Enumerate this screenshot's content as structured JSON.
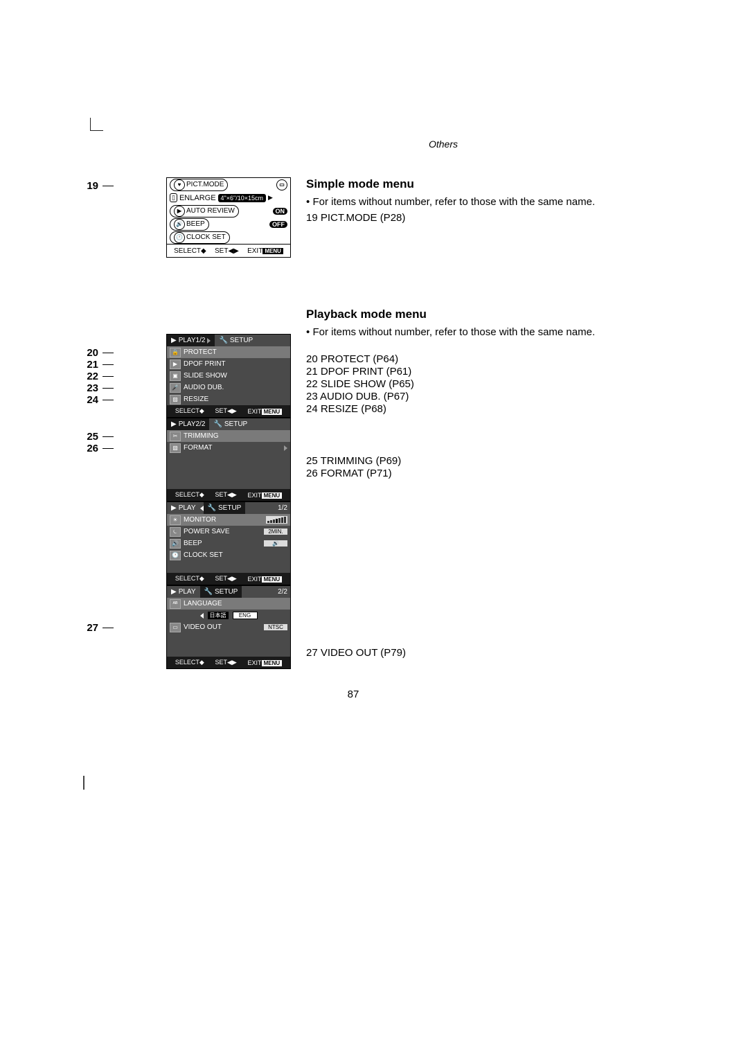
{
  "header": "Others",
  "page_number": "87",
  "simple": {
    "title": "Simple mode menu",
    "note_bullet": "•",
    "note": "For items without number, refer to those with the same name.",
    "items": [
      "19  PICT.MODE (P28)"
    ],
    "callout": "19",
    "screen": {
      "row1_label": "PICT.MODE",
      "row2_label": "ENLARGE",
      "row2_value": "4\"×6\"/10×15cm",
      "row3_label": "AUTO REVIEW",
      "row3_value": "ON",
      "row4_label": "BEEP",
      "row4_value": "OFF",
      "row5_label": "CLOCK SET",
      "footer_select": "SELECT",
      "footer_set": "SET",
      "footer_exit": "EXIT",
      "footer_menu": "MENU"
    }
  },
  "playback": {
    "title": "Playback mode menu",
    "note_bullet": "•",
    "note": "For items without number, refer to those with the same name.",
    "list1": [
      "20  PROTECT (P64)",
      "21  DPOF PRINT (P61)",
      "22  SLIDE SHOW (P65)",
      "23  AUDIO DUB. (P67)",
      "24  RESIZE (P68)"
    ],
    "list2": [
      "25  TRIMMING (P69)",
      "26  FORMAT (P71)"
    ],
    "list3": [
      "27  VIDEO OUT (P79)"
    ],
    "callouts1": [
      "20",
      "21",
      "22",
      "23",
      "24"
    ],
    "callouts2": [
      "25",
      "26"
    ],
    "callouts3": [
      "27"
    ],
    "screen1": {
      "tab1": "PLAY1/2",
      "tab2": "SETUP",
      "rows": [
        "PROTECT",
        "DPOF PRINT",
        "SLIDE SHOW",
        "AUDIO DUB.",
        "RESIZE"
      ],
      "footer_select": "SELECT",
      "footer_set": "SET",
      "footer_exit": "EXIT",
      "footer_menu": "MENU"
    },
    "screen2": {
      "tab1": "PLAY2/2",
      "tab2": "SETUP",
      "rows": [
        "TRIMMING",
        "FORMAT"
      ],
      "footer_select": "SELECT",
      "footer_set": "SET",
      "footer_exit": "EXIT",
      "footer_menu": "MENU"
    },
    "screen3": {
      "tab1": "PLAY",
      "tab2": "SETUP",
      "page": "1/2",
      "rows": [
        {
          "label": "MONITOR",
          "value": "bars"
        },
        {
          "label": "POWER SAVE",
          "value": "2MIN."
        },
        {
          "label": "BEEP",
          "value": "🔊"
        },
        {
          "label": "CLOCK SET",
          "value": ""
        }
      ],
      "footer_select": "SELECT",
      "footer_set": "SET",
      "footer_exit": "EXIT",
      "footer_menu": "MENU"
    },
    "screen4": {
      "tab1": "PLAY",
      "tab2": "SETUP",
      "page": "2/2",
      "lang_label": "LANGUAGE",
      "lang_jp": "日本語",
      "lang_en": "ENG",
      "video_label": "VIDEO OUT",
      "video_value": "NTSC",
      "footer_select": "SELECT",
      "footer_set": "SET",
      "footer_exit": "EXIT",
      "footer_menu": "MENU"
    }
  }
}
